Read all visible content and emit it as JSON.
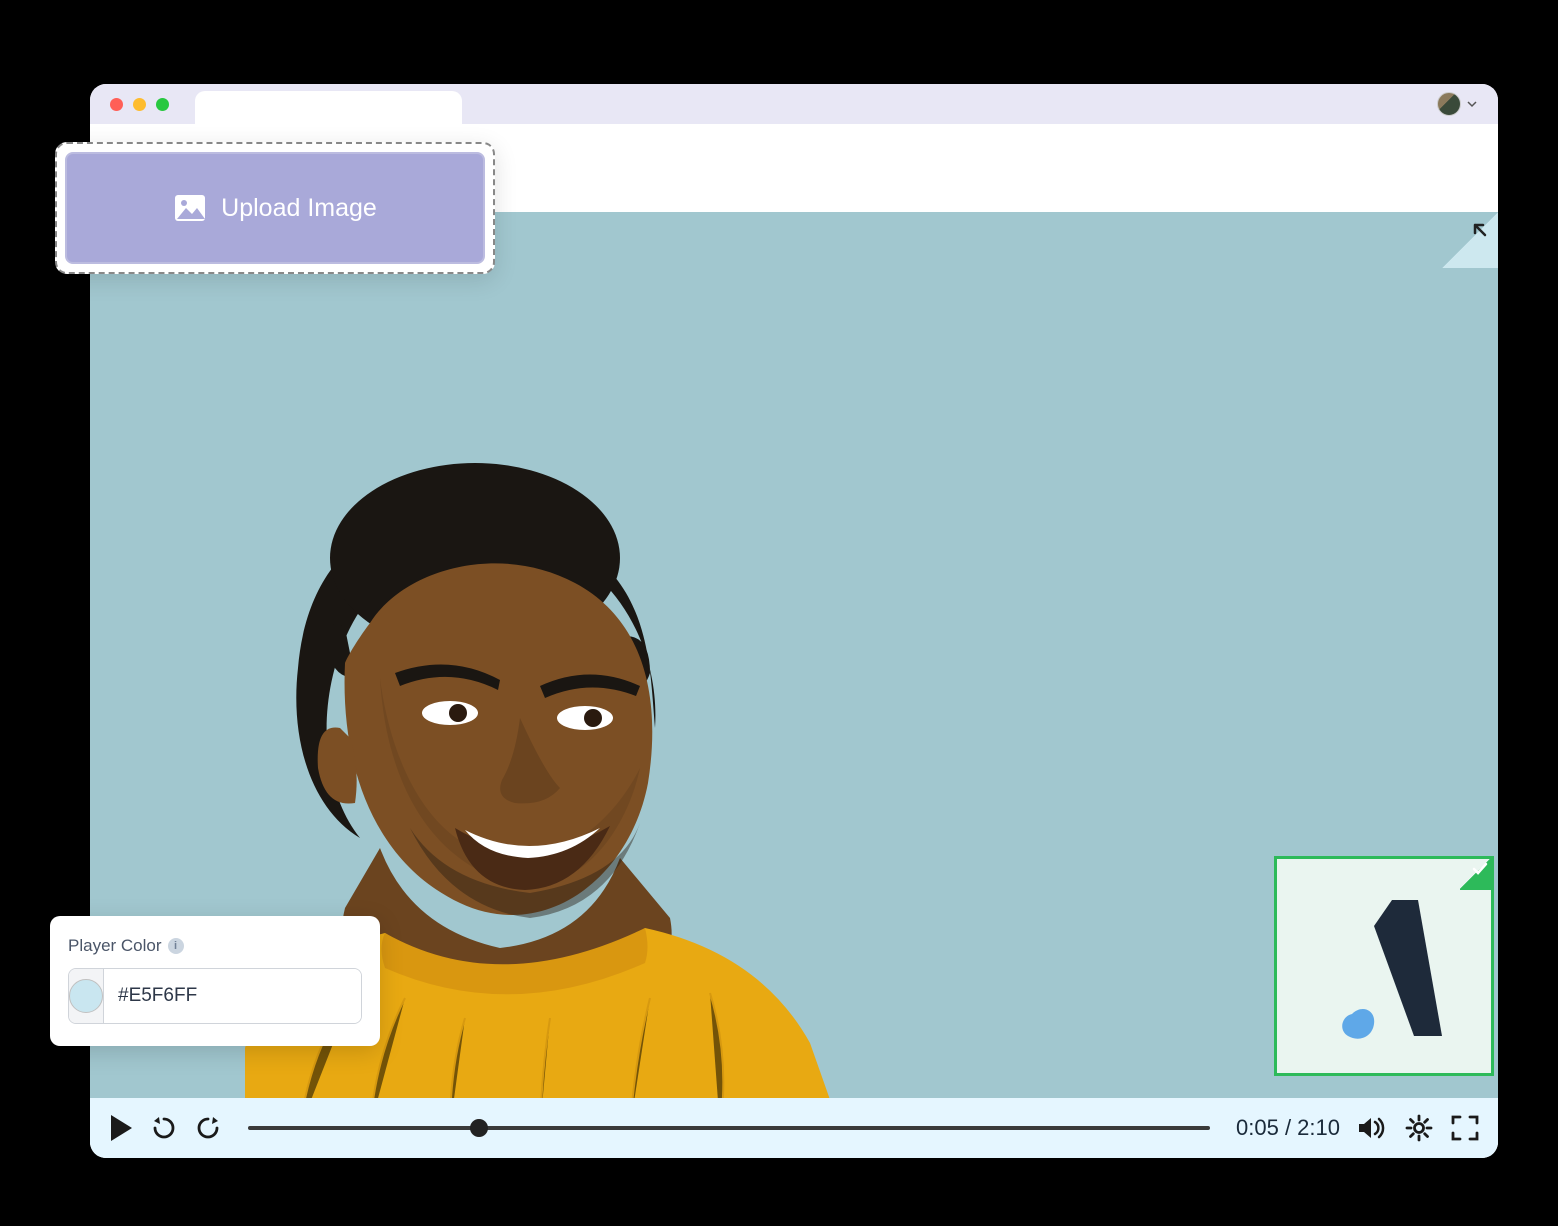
{
  "upload": {
    "button_label": "Upload Image"
  },
  "player_color": {
    "label": "Player Color",
    "value": "#E5F6FF",
    "swatch": "#c9e6f0"
  },
  "player": {
    "current_time": "0:05",
    "duration": "2:10",
    "progress_percent": 24
  },
  "video": {
    "background_color": "#a1c7cf"
  },
  "logo_card": {
    "border_color": "#2dba5a",
    "bg_color": "#eaf5f0"
  }
}
